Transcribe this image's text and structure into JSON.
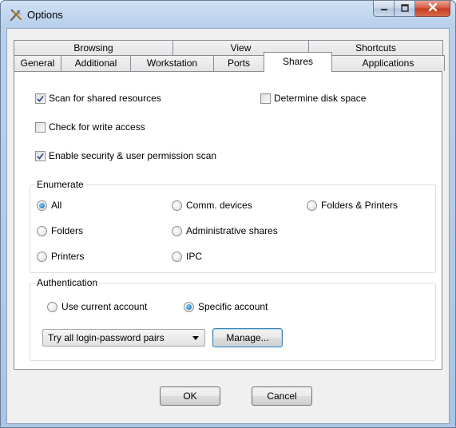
{
  "window": {
    "title": "Options",
    "app_icon": "tools-icon"
  },
  "tabs": {
    "back_row": [
      {
        "label": "Browsing"
      },
      {
        "label": "View"
      },
      {
        "label": "Shortcuts"
      }
    ],
    "front_row": [
      {
        "label": "General"
      },
      {
        "label": "Additional"
      },
      {
        "label": "Workstation"
      },
      {
        "label": "Ports"
      },
      {
        "label": "Shares",
        "selected": true
      },
      {
        "label": "Applications"
      }
    ]
  },
  "shares": {
    "scan_shared": {
      "label": "Scan for shared resources",
      "checked": true
    },
    "determine_disk": {
      "label": "Determine disk space",
      "checked": false
    },
    "check_write": {
      "label": "Check for write access",
      "checked": false
    },
    "enable_security": {
      "label": "Enable security & user permission scan",
      "checked": true
    },
    "enumerate": {
      "title": "Enumerate",
      "options": {
        "all": {
          "label": "All",
          "selected": true
        },
        "comm_devices": {
          "label": "Comm. devices",
          "selected": false
        },
        "folders_printers": {
          "label": "Folders & Printers",
          "selected": false
        },
        "folders": {
          "label": "Folders",
          "selected": false
        },
        "admin_shares": {
          "label": "Administrative shares",
          "selected": false
        },
        "printers": {
          "label": "Printers",
          "selected": false
        },
        "ipc": {
          "label": "IPC",
          "selected": false
        }
      }
    },
    "authentication": {
      "title": "Authentication",
      "use_current": {
        "label": "Use current account",
        "selected": false
      },
      "specific": {
        "label": "Specific account",
        "selected": true
      },
      "login_mode": {
        "value": "Try all login-password pairs"
      },
      "manage_label": "Manage..."
    }
  },
  "buttons": {
    "ok": "OK",
    "cancel": "Cancel"
  }
}
